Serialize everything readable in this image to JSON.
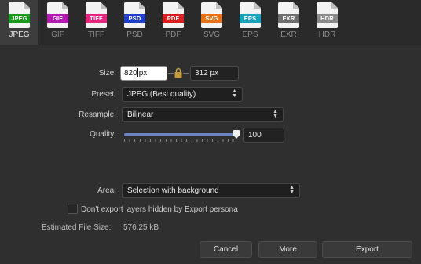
{
  "formats": [
    {
      "label": "JPEG",
      "badge": "JPEG",
      "color": "#1a9a1a",
      "active": true
    },
    {
      "label": "GIF",
      "badge": "GIF",
      "color": "#b01ab0",
      "active": false
    },
    {
      "label": "TIFF",
      "badge": "TIFF",
      "color": "#e6257e",
      "active": false
    },
    {
      "label": "PSD",
      "badge": "PSD",
      "color": "#1f3fc8",
      "active": false
    },
    {
      "label": "PDF",
      "badge": "PDF",
      "color": "#d81e1e",
      "active": false
    },
    {
      "label": "SVG",
      "badge": "SVG",
      "color": "#e8721a",
      "active": false
    },
    {
      "label": "EPS",
      "badge": "EPS",
      "color": "#1aa3b8",
      "active": false
    },
    {
      "label": "EXR",
      "badge": "EXR",
      "color": "#6e6e6e",
      "active": false
    },
    {
      "label": "HDR",
      "badge": "HDR",
      "color": "#8a8a8a",
      "active": false
    }
  ],
  "size": {
    "label": "Size:",
    "width_value": "820",
    "width_unit": "px",
    "height_value": "312 px",
    "lock_icon": "lock-icon"
  },
  "preset": {
    "label": "Preset:",
    "value": "JPEG (Best quality)"
  },
  "resample": {
    "label": "Resample:",
    "value": "Bilinear"
  },
  "quality": {
    "label": "Quality:",
    "value": "100",
    "slider_fraction": 1.0
  },
  "area": {
    "label": "Area:",
    "value": "Selection with background"
  },
  "hidden_layers": {
    "label": "Don't export layers hidden by Export persona",
    "checked": false
  },
  "estimate": {
    "label": "Estimated File Size:",
    "value": "576.25 kB"
  },
  "buttons": {
    "cancel": "Cancel",
    "more": "More",
    "export": "Export"
  }
}
